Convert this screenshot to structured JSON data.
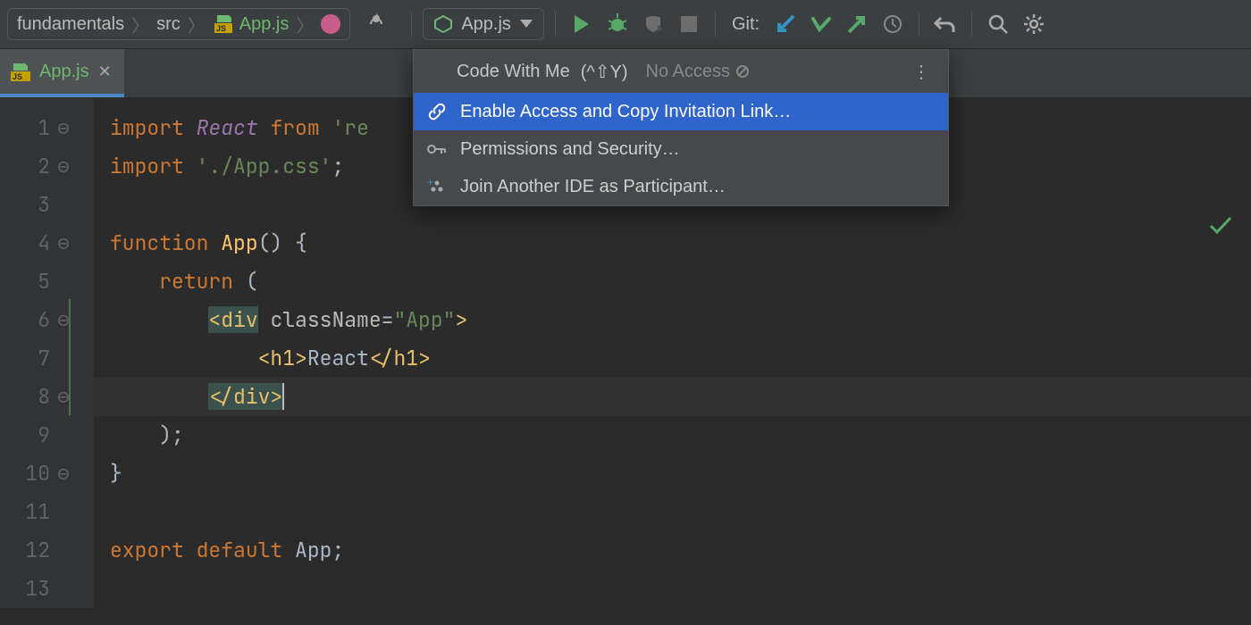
{
  "breadcrumb": {
    "project": "fundamentals",
    "folder": "src",
    "file": "App.js"
  },
  "run_config": "App.js",
  "git_label": "Git:",
  "tab": {
    "name": "App.js"
  },
  "popup": {
    "title": "Code With Me",
    "shortcut": "(^⇧Y)",
    "access": "No Access",
    "items": [
      "Enable Access and Copy Invitation Link…",
      "Permissions and Security…",
      "Join Another IDE as Participant…"
    ]
  },
  "code": {
    "l1_import": "import",
    "l1_react": "React",
    "l1_from": "from",
    "l1_str": "'re",
    "l2_import": "import",
    "l2_str": "'./App.css'",
    "l4_function": "function",
    "l4_app": "App",
    "l5_return": "return",
    "l6_div": "div",
    "l6_className": "className",
    "l6_val": "\"App\"",
    "l7_h1": "h1",
    "l7_text": "React",
    "l12_export": "export",
    "l12_default": "default",
    "l12_app": "App"
  },
  "lines": [
    "1",
    "2",
    "3",
    "4",
    "5",
    "6",
    "7",
    "8",
    "9",
    "10",
    "11",
    "12",
    "13"
  ]
}
